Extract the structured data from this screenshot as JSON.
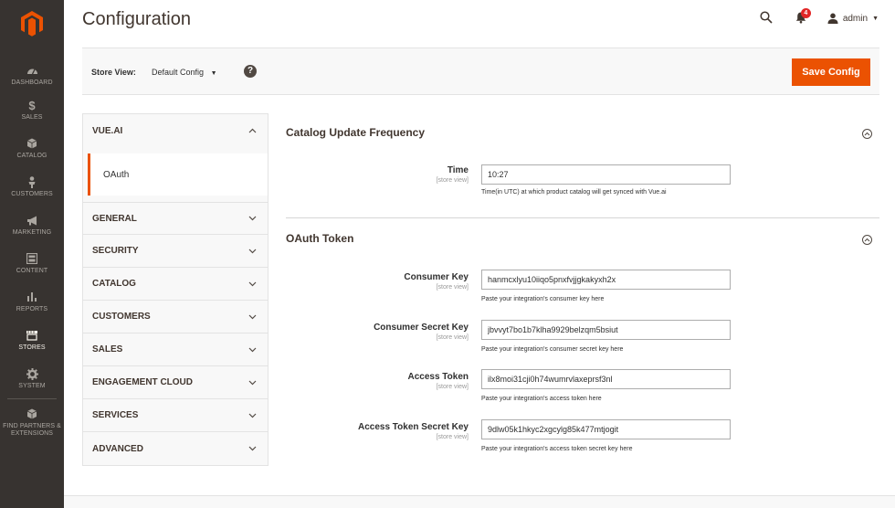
{
  "nav": {
    "items": [
      {
        "label": "DASHBOARD",
        "icon": "dashboard-icon"
      },
      {
        "label": "SALES",
        "icon": "dollar-icon"
      },
      {
        "label": "CATALOG",
        "icon": "cube-icon"
      },
      {
        "label": "CUSTOMERS",
        "icon": "person-icon"
      },
      {
        "label": "MARKETING",
        "icon": "megaphone-icon"
      },
      {
        "label": "CONTENT",
        "icon": "layout-icon"
      },
      {
        "label": "REPORTS",
        "icon": "bar-chart-icon"
      },
      {
        "label": "STORES",
        "icon": "store-icon"
      },
      {
        "label": "SYSTEM",
        "icon": "gear-icon"
      },
      {
        "label": "FIND PARTNERS & EXTENSIONS",
        "icon": "box-icon"
      }
    ]
  },
  "header": {
    "title": "Configuration",
    "notification_count": "4",
    "user": "admin"
  },
  "storebar": {
    "label": "Store View:",
    "value": "Default Config",
    "help": "?",
    "save_label": "Save Config"
  },
  "tabs": {
    "open": {
      "label": "VUE.AI",
      "sub": "OAuth"
    },
    "items": [
      "GENERAL",
      "SECURITY",
      "CATALOG",
      "CUSTOMERS",
      "SALES",
      "ENGAGEMENT CLOUD",
      "SERVICES",
      "ADVANCED"
    ]
  },
  "catalog_section": {
    "title": "Catalog Update Frequency",
    "time_label": "Time",
    "time_scope": "[store view]",
    "time_value": "10:27",
    "time_note": "Time(in UTC) at which product catalog will get synced with Vue.ai"
  },
  "oauth_section": {
    "title": "OAuth Token",
    "fields": [
      {
        "label": "Consumer Key",
        "scope": "[store view]",
        "value": "hanmcxlyu10iiqo5pnxfvjjgkakyxh2x",
        "note": "Paste your integration's consumer key here"
      },
      {
        "label": "Consumer Secret Key",
        "scope": "[store view]",
        "value": "jbvvyt7bo1b7klha9929belzqm5bsiut",
        "note": "Paste your integration's consumer secret key here"
      },
      {
        "label": "Access Token",
        "scope": "[store view]",
        "value": "ilx8moi31cji0h74wumrvlaxeprsf3nl",
        "note": "Paste your integration's access token here"
      },
      {
        "label": "Access Token Secret Key",
        "scope": "[store view]",
        "value": "9dlw05k1hkyc2xgcylg85k477mtjogit",
        "note": "Paste your integration's access token secret key here"
      }
    ]
  },
  "colors": {
    "accent": "#eb5202",
    "nav_bg": "#373330"
  }
}
